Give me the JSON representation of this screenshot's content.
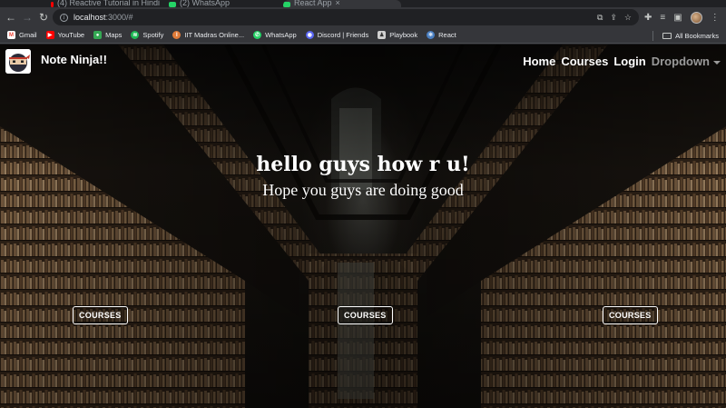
{
  "browser": {
    "tabs": [
      {
        "title": "(4) Reactive Tutorial in Hindi",
        "favicon_color": "#ff0000"
      },
      {
        "title": "(2) WhatsApp",
        "favicon_color": "#25d366"
      },
      {
        "title": "React App",
        "favicon_color": "#25d366"
      }
    ],
    "url_host": "localhost",
    "url_path": ":3000/#",
    "bookmarks": [
      {
        "label": "Gmail",
        "icon": "gmail-icon",
        "color": "#ea4335"
      },
      {
        "label": "YouTube",
        "icon": "youtube-icon",
        "color": "#ff0000"
      },
      {
        "label": "Maps",
        "icon": "maps-icon",
        "color": "#34a853"
      },
      {
        "label": "Spotify",
        "icon": "spotify-icon",
        "color": "#1db954"
      },
      {
        "label": "IIT Madras Online...",
        "icon": "iitm-icon",
        "color": "#e07b39"
      },
      {
        "label": "WhatsApp",
        "icon": "whatsapp-icon",
        "color": "#25d366"
      },
      {
        "label": "Discord | Friends",
        "icon": "discord-icon",
        "color": "#5865f2"
      },
      {
        "label": "Playbook",
        "icon": "playbook-icon",
        "color": "#d0d0d0"
      },
      {
        "label": "React",
        "icon": "react-icon",
        "color": "#4a7fc1"
      }
    ],
    "all_bookmarks_label": "All Bookmarks"
  },
  "site": {
    "brand": "Note Ninja!!",
    "nav": {
      "home": "Home",
      "courses": "Courses",
      "login": "Login",
      "dropdown": "Dropdown"
    },
    "hero": {
      "title": "hello guys how r u!",
      "subtitle": "Hope you guys are doing good"
    },
    "course_buttons": [
      "COURSES",
      "COURSES",
      "COURSES"
    ]
  }
}
